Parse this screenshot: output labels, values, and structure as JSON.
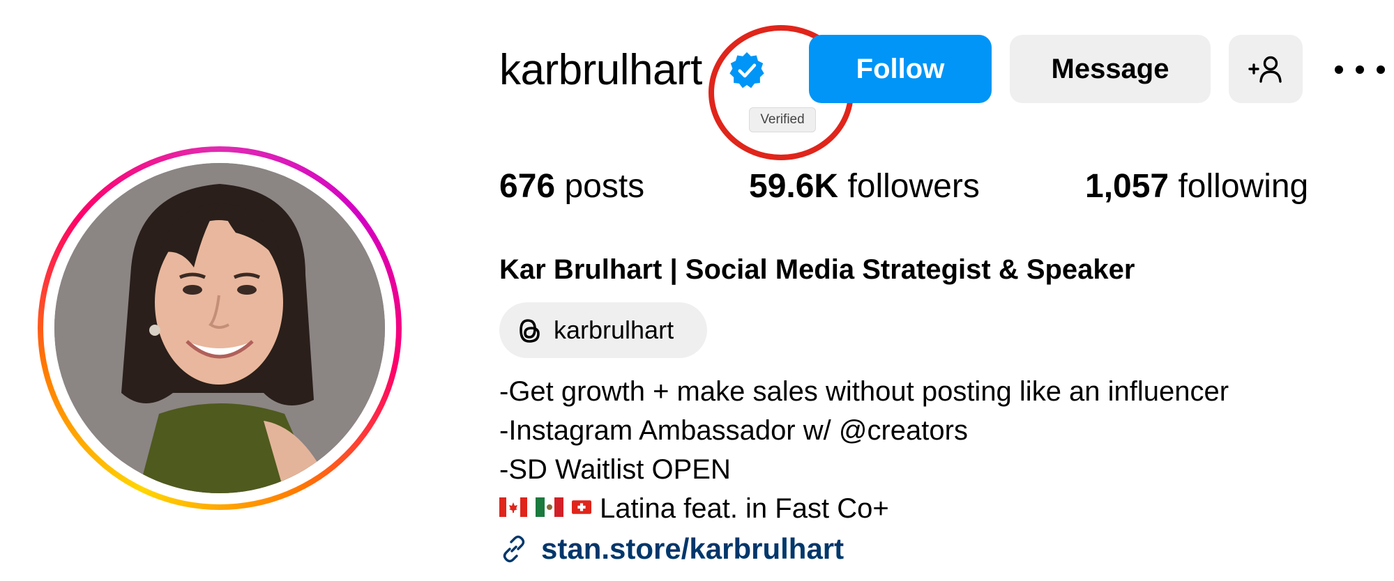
{
  "profile": {
    "username": "karbrulhart",
    "verified_tooltip": "Verified",
    "buttons": {
      "follow": "Follow",
      "message": "Message"
    },
    "stats": {
      "posts_count": "676",
      "posts_label": "posts",
      "followers_count": "59.6K",
      "followers_label": "followers",
      "following_count": "1,057",
      "following_label": "following"
    },
    "full_name": "Kar Brulhart | Social Media Strategist & Speaker",
    "threads_handle": "karbrulhart",
    "bio": {
      "line1": "-Get growth + make sales without posting like an influencer",
      "line2": "-Instagram Ambassador w/ @creators",
      "line3": "-SD Waitlist OPEN",
      "line4_text": "Latina feat. in Fast Co+"
    },
    "link": "stan.store/karbrulhart"
  },
  "icons": {
    "verified": "verified-badge-icon",
    "add_user": "add-person-icon",
    "more": "more-options-icon",
    "threads": "threads-icon",
    "link": "link-icon",
    "flags": [
      "canada-flag",
      "mexico-flag",
      "switzerland-flag"
    ]
  },
  "colors": {
    "follow_button": "#0095f6",
    "link": "#00376b",
    "verified_badge": "#0095f6",
    "highlight_circle": "#e0251b"
  }
}
